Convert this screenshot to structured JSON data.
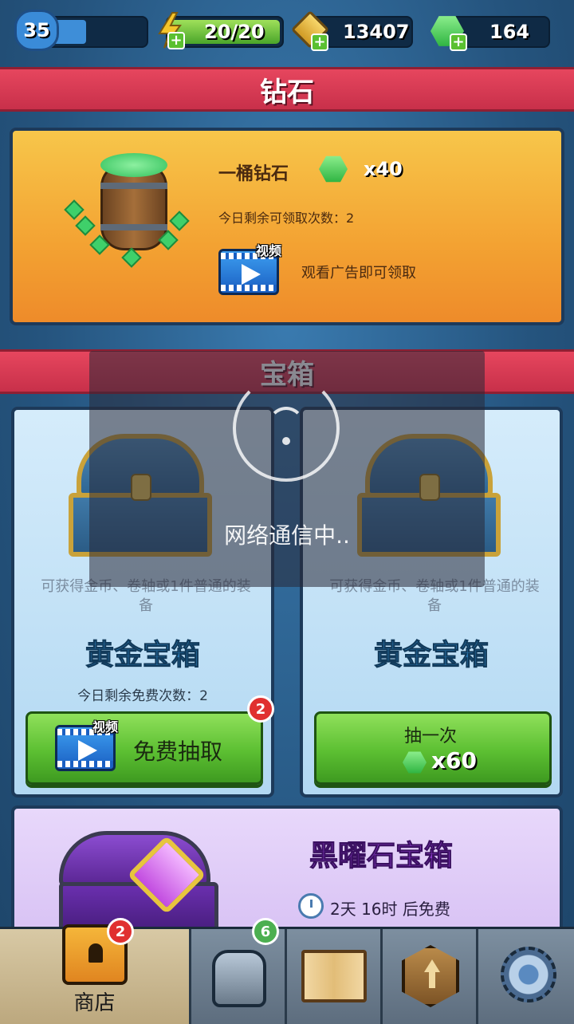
{
  "top_bar": {
    "level": "35",
    "energy": "20/20",
    "coins": "13407",
    "gems": "164"
  },
  "sections": {
    "diamond_title": "钻石",
    "chest_title": "宝箱"
  },
  "diamond_offer": {
    "title": "一桶钻石",
    "amount": "x40",
    "remaining": "今日剩余可领取次数：2",
    "video_label": "视频",
    "watch_text": "观看广告即可领取"
  },
  "chest_left": {
    "description": "可获得金币、卷轴或1件普通的装备",
    "name": "黄金宝箱",
    "remaining": "今日剩余免费次数：2",
    "video_label": "视频",
    "button_label": "免费抽取",
    "badge": "2"
  },
  "chest_right": {
    "description": "可获得金币、卷轴或1件普通的装备",
    "name": "黄金宝箱",
    "button_label": "抽一次",
    "price": "x60"
  },
  "obsidian_chest": {
    "name": "黑曜石宝箱",
    "timer_text": "2天 16时 后免费"
  },
  "bottom_nav": {
    "shop_label": "商店",
    "shop_badge": "2",
    "armor_badge": "6"
  },
  "overlay": {
    "text": "网络通信中.."
  },
  "colors": {
    "header_red": "#d83a52",
    "gem_green": "#3fd06a",
    "button_green": "#5cbf32",
    "orange_card": "#f3a232"
  }
}
